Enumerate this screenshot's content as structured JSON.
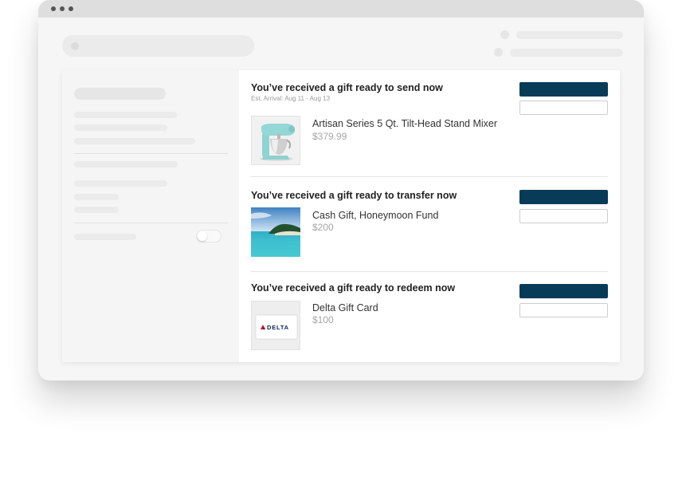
{
  "colors": {
    "primary_button": "#073b57",
    "secondary_button_border": "#cdcdcd",
    "price_text": "#a6a6a6"
  },
  "gifts": [
    {
      "title": "You’ve received a gift ready to send now",
      "subtitle": "Est. Arrival: Aug 11 - Aug 13",
      "product_name": "Artisan Series 5 Qt. Tilt-Head Stand Mixer",
      "price": "$379.99",
      "thumbnail_icon": "stand-mixer-image"
    },
    {
      "title": "You’ve received a gift ready to transfer now",
      "product_name": "Cash Gift, Honeymoon Fund",
      "price": "$200",
      "thumbnail_icon": "beach-image"
    },
    {
      "title": "You’ve received a gift ready to redeem now",
      "product_name": "Delta Gift Card",
      "price": "$100",
      "thumbnail_icon": "delta-gift-card-image"
    }
  ]
}
